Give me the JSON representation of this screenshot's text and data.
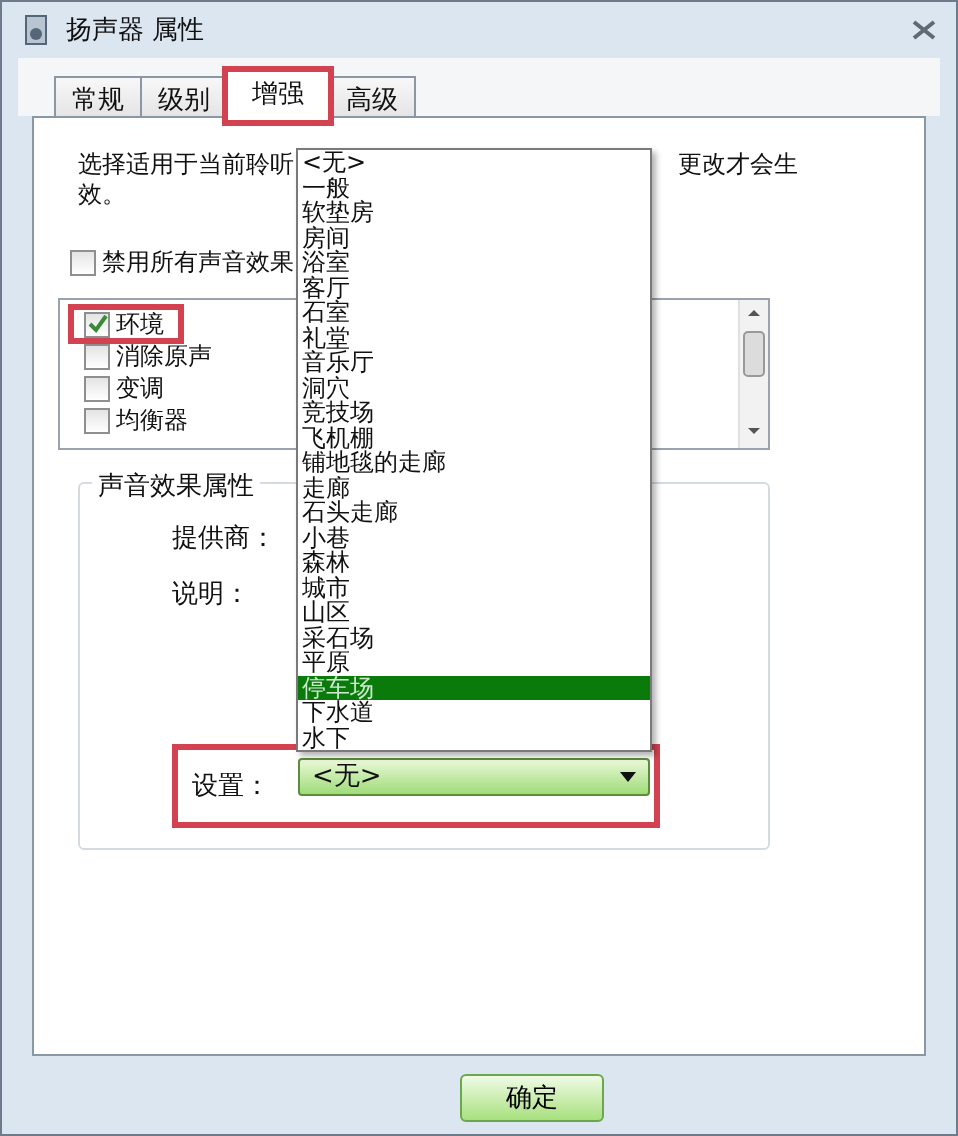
{
  "window": {
    "title": "扬声器 属性"
  },
  "tabs": [
    {
      "label": "常规",
      "selected": false,
      "highlighted": false
    },
    {
      "label": "级别",
      "selected": false,
      "highlighted": false
    },
    {
      "label": "增强",
      "selected": true,
      "highlighted": true
    },
    {
      "label": "高级",
      "selected": false,
      "highlighted": false
    }
  ],
  "intro": {
    "before": "选择适用于当前聆听",
    "after": "更改才会生",
    "line_2": "效。"
  },
  "disable_all": {
    "label": "禁用所有声音效果",
    "checked": false
  },
  "effects": [
    {
      "label": "环境",
      "checked": true,
      "highlighted": true
    },
    {
      "label": "消除原声",
      "checked": false,
      "highlighted": false
    },
    {
      "label": "变调",
      "checked": false,
      "highlighted": false
    },
    {
      "label": "均衡器",
      "checked": false,
      "highlighted": false
    }
  ],
  "properties": {
    "title": "声音效果属性",
    "provider_label": "提供商：",
    "description_label": "说明：",
    "setting_label": "设置：",
    "setting_value": "<无>",
    "setting_highlighted": true
  },
  "dropdown": {
    "expanded": true,
    "options": [
      {
        "label": "<无>",
        "selected": false
      },
      {
        "label": "一般",
        "selected": false
      },
      {
        "label": "软垫房",
        "selected": false
      },
      {
        "label": "房间",
        "selected": false
      },
      {
        "label": "浴室",
        "selected": false
      },
      {
        "label": "客厅",
        "selected": false
      },
      {
        "label": "石室",
        "selected": false
      },
      {
        "label": "礼堂",
        "selected": false
      },
      {
        "label": "音乐厅",
        "selected": false
      },
      {
        "label": "洞穴",
        "selected": false
      },
      {
        "label": "竞技场",
        "selected": false
      },
      {
        "label": "飞机棚",
        "selected": false
      },
      {
        "label": "铺地毯的走廊",
        "selected": false
      },
      {
        "label": "走廊",
        "selected": false
      },
      {
        "label": "石头走廊",
        "selected": false
      },
      {
        "label": "小巷",
        "selected": false
      },
      {
        "label": "森林",
        "selected": false
      },
      {
        "label": "城市",
        "selected": false
      },
      {
        "label": "山区",
        "selected": false
      },
      {
        "label": "采石场",
        "selected": false
      },
      {
        "label": "平原",
        "selected": false
      },
      {
        "label": "停车场",
        "selected": true
      },
      {
        "label": "下水道",
        "selected": false
      },
      {
        "label": "水下",
        "selected": false
      }
    ]
  },
  "buttons": [
    "确定"
  ]
}
